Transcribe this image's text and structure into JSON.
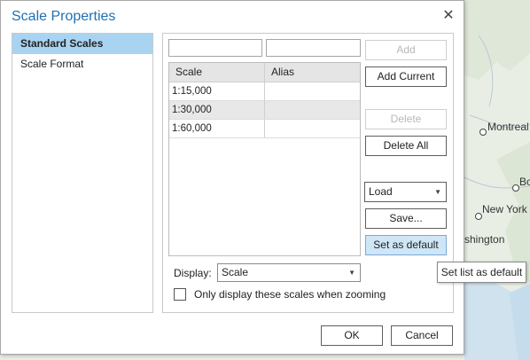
{
  "dialog": {
    "title": "Scale Properties",
    "close_icon": "close-icon"
  },
  "nav": {
    "items": [
      {
        "label": "Standard Scales",
        "selected": true
      },
      {
        "label": "Scale Format",
        "selected": false
      }
    ]
  },
  "scale_input": {
    "value": "",
    "placeholder": ""
  },
  "alias_input": {
    "value": "",
    "placeholder": ""
  },
  "table": {
    "columns": [
      "Scale",
      "Alias"
    ],
    "rows": [
      {
        "scale": "1:15,000",
        "alias": ""
      },
      {
        "scale": "1:30,000",
        "alias": ""
      },
      {
        "scale": "1:60,000",
        "alias": ""
      }
    ]
  },
  "buttons": {
    "add": "Add",
    "add_current": "Add Current",
    "delete": "Delete",
    "delete_all": "Delete All",
    "save": "Save...",
    "set_default": "Set as default",
    "ok": "OK",
    "cancel": "Cancel"
  },
  "load_dropdown": {
    "value": "Load"
  },
  "display": {
    "label": "Display:",
    "value": "Scale"
  },
  "zoom_option": {
    "label": "Only display these scales when zooming",
    "checked": false
  },
  "tooltip": {
    "text": "Set list as default"
  },
  "map": {
    "labels": [
      "Montreal",
      "Bo",
      "New York",
      "shington"
    ]
  },
  "colors": {
    "accent": "#1f6fb5",
    "selection": "#a8d4f2",
    "hover_button": "#cfe6f7"
  }
}
